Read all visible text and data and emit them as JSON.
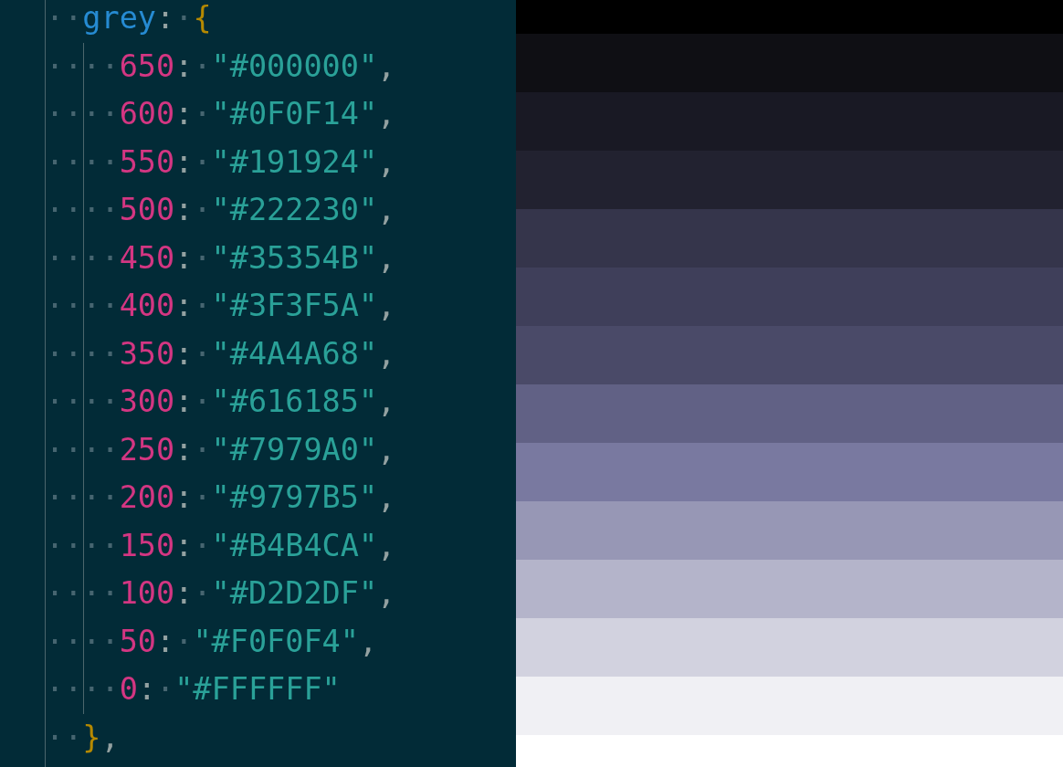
{
  "editor": {
    "open": {
      "tokens": [
        {
          "kind": "space",
          "text": "··"
        },
        {
          "kind": "property",
          "text": "grey"
        },
        {
          "kind": "punct",
          "text": ":"
        },
        {
          "kind": "space",
          "text": "·"
        },
        {
          "kind": "brace",
          "text": "{"
        }
      ]
    },
    "children": [
      {
        "tokens": [
          {
            "kind": "space",
            "text": "····"
          },
          {
            "kind": "key",
            "text": "650"
          },
          {
            "kind": "punct",
            "text": ":"
          },
          {
            "kind": "space",
            "text": "·"
          },
          {
            "kind": "string",
            "text": "\"#000000\""
          },
          {
            "kind": "punct",
            "text": ","
          }
        ]
      },
      {
        "tokens": [
          {
            "kind": "space",
            "text": "····"
          },
          {
            "kind": "key",
            "text": "600"
          },
          {
            "kind": "punct",
            "text": ":"
          },
          {
            "kind": "space",
            "text": "·"
          },
          {
            "kind": "string",
            "text": "\"#0F0F14\""
          },
          {
            "kind": "punct",
            "text": ","
          }
        ]
      },
      {
        "tokens": [
          {
            "kind": "space",
            "text": "····"
          },
          {
            "kind": "key",
            "text": "550"
          },
          {
            "kind": "punct",
            "text": ":"
          },
          {
            "kind": "space",
            "text": "·"
          },
          {
            "kind": "string",
            "text": "\"#191924\""
          },
          {
            "kind": "punct",
            "text": ","
          }
        ]
      },
      {
        "tokens": [
          {
            "kind": "space",
            "text": "····"
          },
          {
            "kind": "key",
            "text": "500"
          },
          {
            "kind": "punct",
            "text": ":"
          },
          {
            "kind": "space",
            "text": "·"
          },
          {
            "kind": "string",
            "text": "\"#222230\""
          },
          {
            "kind": "punct",
            "text": ","
          }
        ]
      },
      {
        "tokens": [
          {
            "kind": "space",
            "text": "····"
          },
          {
            "kind": "key",
            "text": "450"
          },
          {
            "kind": "punct",
            "text": ":"
          },
          {
            "kind": "space",
            "text": "·"
          },
          {
            "kind": "string",
            "text": "\"#35354B\""
          },
          {
            "kind": "punct",
            "text": ","
          }
        ]
      },
      {
        "tokens": [
          {
            "kind": "space",
            "text": "····"
          },
          {
            "kind": "key",
            "text": "400"
          },
          {
            "kind": "punct",
            "text": ":"
          },
          {
            "kind": "space",
            "text": "·"
          },
          {
            "kind": "string",
            "text": "\"#3F3F5A\""
          },
          {
            "kind": "punct",
            "text": ","
          }
        ]
      },
      {
        "tokens": [
          {
            "kind": "space",
            "text": "····"
          },
          {
            "kind": "key",
            "text": "350"
          },
          {
            "kind": "punct",
            "text": ":"
          },
          {
            "kind": "space",
            "text": "·"
          },
          {
            "kind": "string",
            "text": "\"#4A4A68\""
          },
          {
            "kind": "punct",
            "text": ","
          }
        ]
      },
      {
        "tokens": [
          {
            "kind": "space",
            "text": "····"
          },
          {
            "kind": "key",
            "text": "300"
          },
          {
            "kind": "punct",
            "text": ":"
          },
          {
            "kind": "space",
            "text": "·"
          },
          {
            "kind": "string",
            "text": "\"#616185\""
          },
          {
            "kind": "punct",
            "text": ","
          }
        ]
      },
      {
        "tokens": [
          {
            "kind": "space",
            "text": "····"
          },
          {
            "kind": "key",
            "text": "250"
          },
          {
            "kind": "punct",
            "text": ":"
          },
          {
            "kind": "space",
            "text": "·"
          },
          {
            "kind": "string",
            "text": "\"#7979A0\""
          },
          {
            "kind": "punct",
            "text": ","
          }
        ]
      },
      {
        "tokens": [
          {
            "kind": "space",
            "text": "····"
          },
          {
            "kind": "key",
            "text": "200"
          },
          {
            "kind": "punct",
            "text": ":"
          },
          {
            "kind": "space",
            "text": "·"
          },
          {
            "kind": "string",
            "text": "\"#9797B5\""
          },
          {
            "kind": "punct",
            "text": ","
          }
        ]
      },
      {
        "tokens": [
          {
            "kind": "space",
            "text": "····"
          },
          {
            "kind": "key",
            "text": "150"
          },
          {
            "kind": "punct",
            "text": ":"
          },
          {
            "kind": "space",
            "text": "·"
          },
          {
            "kind": "string",
            "text": "\"#B4B4CA\""
          },
          {
            "kind": "punct",
            "text": ","
          }
        ]
      },
      {
        "tokens": [
          {
            "kind": "space",
            "text": "····"
          },
          {
            "kind": "key",
            "text": "100"
          },
          {
            "kind": "punct",
            "text": ":"
          },
          {
            "kind": "space",
            "text": "·"
          },
          {
            "kind": "string",
            "text": "\"#D2D2DF\""
          },
          {
            "kind": "punct",
            "text": ","
          }
        ]
      },
      {
        "tokens": [
          {
            "kind": "space",
            "text": "····"
          },
          {
            "kind": "key",
            "text": "50"
          },
          {
            "kind": "punct",
            "text": ":"
          },
          {
            "kind": "space",
            "text": "·"
          },
          {
            "kind": "string",
            "text": "\"#F0F0F4\""
          },
          {
            "kind": "punct",
            "text": ","
          }
        ]
      },
      {
        "tokens": [
          {
            "kind": "space",
            "text": "····"
          },
          {
            "kind": "key",
            "text": "0"
          },
          {
            "kind": "punct",
            "text": ":"
          },
          {
            "kind": "space",
            "text": "·"
          },
          {
            "kind": "string",
            "text": "\"#FFFFFF\""
          }
        ]
      }
    ],
    "close": {
      "tokens": [
        {
          "kind": "space",
          "text": "··"
        },
        {
          "kind": "brace",
          "text": "}"
        },
        {
          "kind": "punct",
          "text": ","
        }
      ]
    }
  },
  "swatches": [
    {
      "color": "#000000"
    },
    {
      "color": "#0f0f14"
    },
    {
      "color": "#191924"
    },
    {
      "color": "#222230"
    },
    {
      "color": "#35354b"
    },
    {
      "color": "#3f3f5a"
    },
    {
      "color": "#4a4a68"
    },
    {
      "color": "#616185"
    },
    {
      "color": "#7979a0"
    },
    {
      "color": "#9797b5"
    },
    {
      "color": "#b4b4ca"
    },
    {
      "color": "#d2d2df"
    },
    {
      "color": "#f0f0f4"
    }
  ]
}
